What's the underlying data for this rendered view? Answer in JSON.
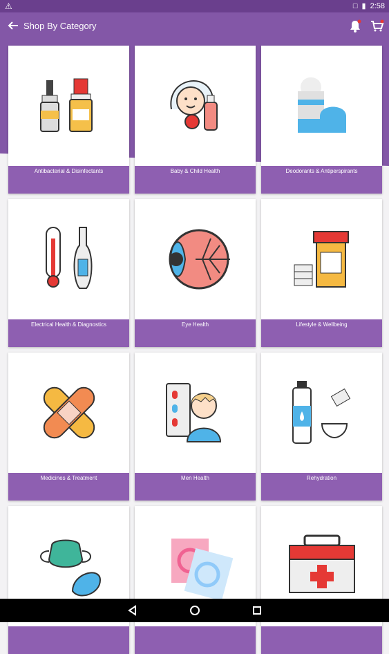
{
  "status": {
    "time": "2:58"
  },
  "app_bar": {
    "title": "Shop By Category"
  },
  "categories": [
    {
      "label": "Antibacterial & Disinfectants",
      "icon": "eye-drop-bottles-icon"
    },
    {
      "label": "Baby & Child Health",
      "icon": "baby-bottle-icon"
    },
    {
      "label": "Deodorants & Antiperspirants",
      "icon": "deodorant-icon"
    },
    {
      "label": "Electrical Health & Diagnostics",
      "icon": "thermometer-icon"
    },
    {
      "label": "Eye Health",
      "icon": "eyeball-icon"
    },
    {
      "label": "Lifestyle & Wellbeing",
      "icon": "pill-bottle-icon"
    },
    {
      "label": "Medicines & Treatment",
      "icon": "bandage-icon"
    },
    {
      "label": "Men Health",
      "icon": "man-pills-icon"
    },
    {
      "label": "Rehydration",
      "icon": "water-bottle-sachet-icon"
    },
    {
      "label": "",
      "icon": "mask-pad-icon"
    },
    {
      "label": "",
      "icon": "sachets-icon"
    },
    {
      "label": "",
      "icon": "first-aid-kit-icon"
    }
  ],
  "colors": {
    "primary": "#8357a7",
    "status": "#6a3f8d",
    "label_bg": "#8e5fb1"
  }
}
